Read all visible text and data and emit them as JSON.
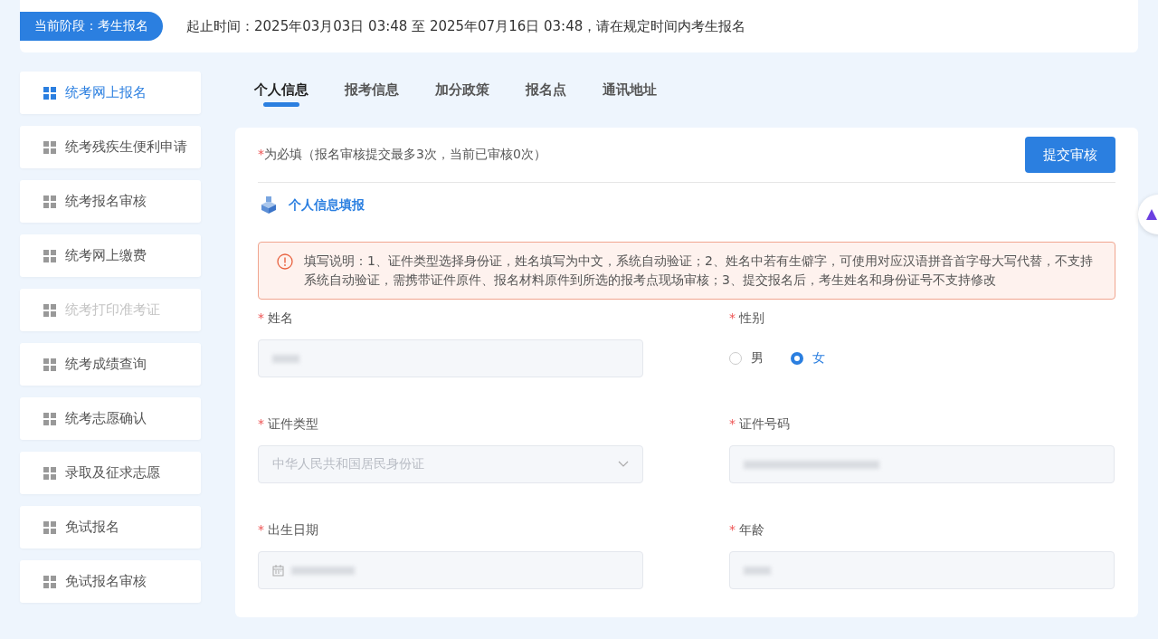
{
  "stage": {
    "label": "当前阶段：考生报名",
    "period": "起止时间：2025年03月03日 03:48 至 2025年07月16日 03:48，请在规定时间内考生报名"
  },
  "sidebar": {
    "items": [
      {
        "label": "统考网上报名",
        "selected": true,
        "disabled": false
      },
      {
        "label": "统考残疾生便利申请",
        "selected": false,
        "disabled": false
      },
      {
        "label": "统考报名审核",
        "selected": false,
        "disabled": false
      },
      {
        "label": "统考网上缴费",
        "selected": false,
        "disabled": false
      },
      {
        "label": "统考打印准考证",
        "selected": false,
        "disabled": true
      },
      {
        "label": "统考成绩查询",
        "selected": false,
        "disabled": false
      },
      {
        "label": "统考志愿确认",
        "selected": false,
        "disabled": false
      },
      {
        "label": "录取及征求志愿",
        "selected": false,
        "disabled": false
      },
      {
        "label": "免试报名",
        "selected": false,
        "disabled": false
      },
      {
        "label": "免试报名审核",
        "selected": false,
        "disabled": false
      }
    ]
  },
  "tabs": [
    {
      "label": "个人信息",
      "selected": true
    },
    {
      "label": "报考信息",
      "selected": false
    },
    {
      "label": "加分政策",
      "selected": false
    },
    {
      "label": "报名点",
      "selected": false
    },
    {
      "label": "通讯地址",
      "selected": false
    }
  ],
  "form": {
    "required_mark": "*",
    "required_note": "为必填（报名审核提交最多3次，当前已审核0次）",
    "submit": "提交审核",
    "section_title": "个人信息填报",
    "notice": "填写说明：1、证件类型选择身份证，姓名填写为中文，系统自动验证；2、姓名中若有生僻字，可使用对应汉语拼音首字母大写代替，不支持系统自动验证，需携带证件原件、报名材料原件到所选的报考点现场审核；3、提交报名后，考生姓名和身份证号不支持修改",
    "fields": [
      {
        "label": "姓名",
        "kind": "blurred"
      },
      {
        "label": "性别",
        "kind": "radio",
        "options": [
          {
            "label": "男",
            "selected": false
          },
          {
            "label": "女",
            "selected": true
          }
        ]
      },
      {
        "label": "证件类型",
        "kind": "select",
        "value": "中华人民共和国居民身份证"
      },
      {
        "label": "证件号码",
        "kind": "blurred"
      },
      {
        "label": "出生日期",
        "kind": "date"
      },
      {
        "label": "年龄",
        "kind": "blurred"
      }
    ]
  }
}
